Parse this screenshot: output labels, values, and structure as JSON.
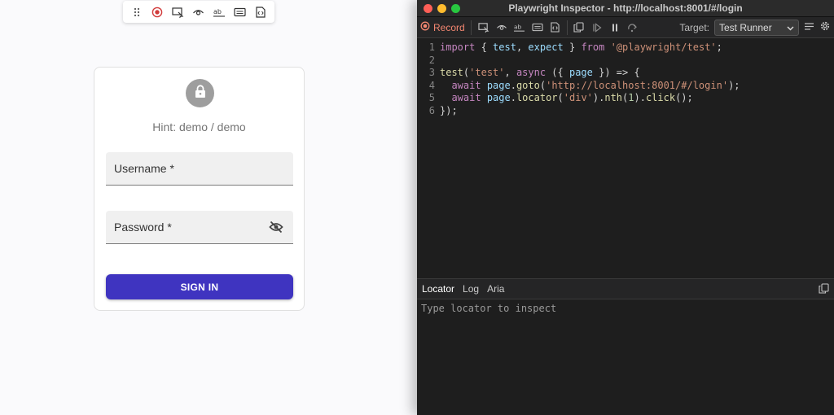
{
  "recorder_toolbar": {
    "icons": [
      "drag-handle-icon",
      "record-icon",
      "pick-locator-icon",
      "assert-visibility-icon",
      "assert-text-icon",
      "assert-value-icon",
      "assert-snapshot-icon"
    ]
  },
  "login": {
    "hint": "Hint: demo / demo",
    "username_label": "Username *",
    "password_label": "Password *",
    "signin_label": "SIGN IN"
  },
  "inspector": {
    "window_title": "Playwright Inspector - http://localhost:8001/#/login",
    "record_label": "Record",
    "target_label": "Target:",
    "target_value": "Test Runner",
    "code_lines": [
      "1",
      "2",
      "3",
      "4",
      "5",
      "6"
    ],
    "tabs": {
      "locator": "Locator",
      "log": "Log",
      "aria": "Aria"
    },
    "locator_placeholder": "Type locator to inspect",
    "colors": {
      "record": "#f48771",
      "keyword": "#c586c0",
      "string": "#ce9178",
      "function": "#dcdcaa"
    }
  },
  "code": {
    "l1": {
      "kw1": "import",
      "p1": " { ",
      "v1": "test",
      "p2": ", ",
      "v2": "expect",
      "p3": " } ",
      "kw2": "from",
      "p4": " ",
      "s1": "'@playwright/test'",
      "p5": ";"
    },
    "l3": {
      "fn1": "test",
      "p1": "(",
      "s1": "'test'",
      "p2": ", ",
      "kw1": "async",
      "p3": " ({ ",
      "v1": "page",
      "p4": " }) => {"
    },
    "l4": {
      "p0": "  ",
      "kw1": "await",
      "p1": " ",
      "v1": "page",
      "p2": ".",
      "fn1": "goto",
      "p3": "(",
      "s1": "'http://localhost:8001/#/login'",
      "p4": ");"
    },
    "l5": {
      "p0": "  ",
      "kw1": "await",
      "p1": " ",
      "v1": "page",
      "p2": ".",
      "fn1": "locator",
      "p3": "(",
      "s1": "'div'",
      "p4": ").",
      "fn2": "nth",
      "p5": "(",
      "n1": "1",
      "p6": ").",
      "fn3": "click",
      "p7": "();"
    },
    "l6": {
      "p1": "});"
    }
  }
}
